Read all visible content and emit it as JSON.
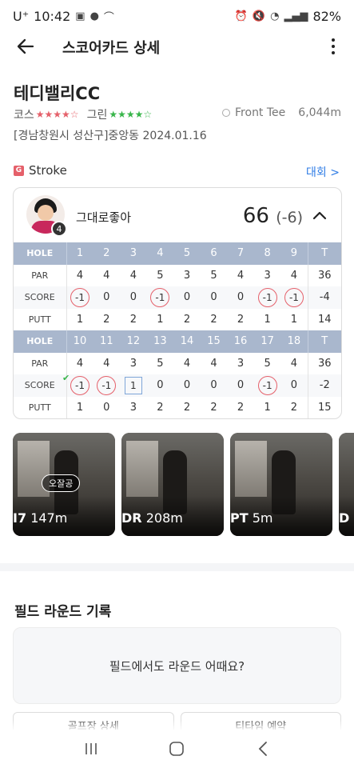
{
  "status_bar": {
    "carrier": "U⁺",
    "time": "10:42",
    "battery": "82%"
  },
  "app_bar": {
    "title": "스코어카드 상세"
  },
  "course": {
    "name": "테디밸리CC",
    "course_label": "코스",
    "course_stars": "★★★★☆",
    "green_label": "그린",
    "green_stars": "★★★★☆",
    "tee_name": "Front Tee",
    "tee_distance": "6,044m",
    "address": "[경남창원시 성산구]중앙동 2024.01.16"
  },
  "mode": {
    "badge": "G",
    "label": "Stroke",
    "link": "대회 >"
  },
  "player": {
    "name": "그대로좋아",
    "level": "4",
    "total": "66",
    "diff": "(-6)"
  },
  "front_nine": {
    "hole_label": "HOLE",
    "par_label": "PAR",
    "score_label": "SCORE",
    "putt_label": "PUTT",
    "holes": [
      "1",
      "2",
      "3",
      "4",
      "5",
      "6",
      "7",
      "8",
      "9"
    ],
    "total_label": "T",
    "par": [
      "4",
      "4",
      "4",
      "5",
      "3",
      "5",
      "4",
      "3",
      "4"
    ],
    "par_total": "36",
    "score": [
      "-1",
      "0",
      "0",
      "-1",
      "0",
      "0",
      "0",
      "-1",
      "-1"
    ],
    "score_total": "-4",
    "putt": [
      "1",
      "2",
      "2",
      "1",
      "2",
      "2",
      "2",
      "1",
      "1"
    ],
    "putt_total": "14"
  },
  "back_nine": {
    "hole_label": "HOLE",
    "par_label": "PAR",
    "score_label": "SCORE",
    "putt_label": "PUTT",
    "holes": [
      "10",
      "11",
      "12",
      "13",
      "14",
      "15",
      "16",
      "17",
      "18"
    ],
    "total_label": "T",
    "par": [
      "4",
      "4",
      "3",
      "5",
      "4",
      "4",
      "3",
      "5",
      "4"
    ],
    "par_total": "36",
    "score": [
      "-1",
      "-1",
      "1",
      "0",
      "0",
      "0",
      "0",
      "-1",
      "0"
    ],
    "score_total": "-2",
    "putt": [
      "1",
      "0",
      "3",
      "2",
      "2",
      "2",
      "2",
      "1",
      "2"
    ],
    "putt_total": "15"
  },
  "clips": [
    {
      "club": "I7",
      "distance": "147m",
      "tag": "오잘공"
    },
    {
      "club": "DR",
      "distance": "208m"
    },
    {
      "club": "PT",
      "distance": "5m"
    },
    {
      "club": "D",
      "distance": ""
    }
  ],
  "field_round": {
    "title": "필드 라운드 기록",
    "prompt": "필드에서도 라운드 어때요?",
    "button_left": "골프장 상세",
    "button_right": "티타임 예약"
  },
  "colors": {
    "accent_blue": "#2d7be5",
    "header_blue": "#a9b7cd",
    "birdie_red": "#e5606a",
    "green_star": "#38b54a"
  },
  "icons": {
    "back": "arrow-left-icon",
    "more": "more-vertical-icon",
    "collapse": "chevron-up-icon"
  }
}
